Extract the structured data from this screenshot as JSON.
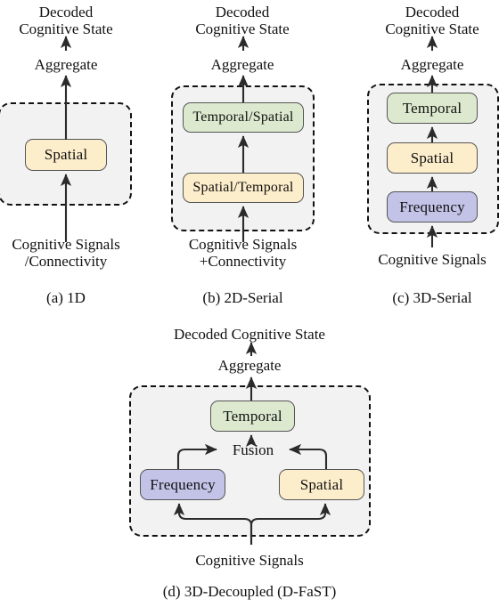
{
  "figure": {
    "background": "#ffffff",
    "panel_fill": "#f2f2f2",
    "panel_border": "#111111",
    "colors": {
      "spatial": "#fdeecb",
      "temporal": "#dde9cf",
      "frequency": "#c3c3e8",
      "box_border": "#555555",
      "arrow": "#333333"
    }
  },
  "panels": [
    {
      "id": "a",
      "caption": "(a) 1D",
      "top_label_line1": "Decoded",
      "top_label_line2": "Cognitive State",
      "aggregate_label": "Aggregate",
      "input_line1": "Cognitive Signals",
      "input_line2": "/Connectivity",
      "boxes": [
        {
          "label": "Spatial",
          "color": "#fdeecb"
        }
      ]
    },
    {
      "id": "b",
      "caption": "(b) 2D-Serial",
      "top_label_line1": "Decoded",
      "top_label_line2": "Cognitive State",
      "aggregate_label": "Aggregate",
      "input_line1": "Cognitive Signals",
      "input_line2": "+Connectivity",
      "boxes": [
        {
          "label": "Temporal/Spatial",
          "color": "#dde9cf"
        },
        {
          "label": "Spatial/Temporal",
          "color": "#fdeecb"
        }
      ]
    },
    {
      "id": "c",
      "caption": "(c) 3D-Serial",
      "top_label_line1": "Decoded",
      "top_label_line2": "Cognitive State",
      "aggregate_label": "Aggregate",
      "input_line1": "Cognitive Signals",
      "input_line2": "",
      "boxes": [
        {
          "label": "Temporal",
          "color": "#dde9cf"
        },
        {
          "label": "Spatial",
          "color": "#fdeecb"
        },
        {
          "label": "Frequency",
          "color": "#c3c3e8"
        }
      ]
    },
    {
      "id": "d",
      "caption": "(d) 3D-Decoupled (D-FaST)",
      "top_label_line1": "Decoded Cognitive State",
      "top_label_line2": "",
      "aggregate_label": "Aggregate",
      "fusion_label": "Fusion",
      "input_line1": "Cognitive Signals",
      "input_line2": "",
      "boxes": [
        {
          "label": "Temporal",
          "color": "#dde9cf"
        },
        {
          "label": "Frequency",
          "color": "#c3c3e8"
        },
        {
          "label": "Spatial",
          "color": "#fdeecb"
        }
      ]
    }
  ]
}
